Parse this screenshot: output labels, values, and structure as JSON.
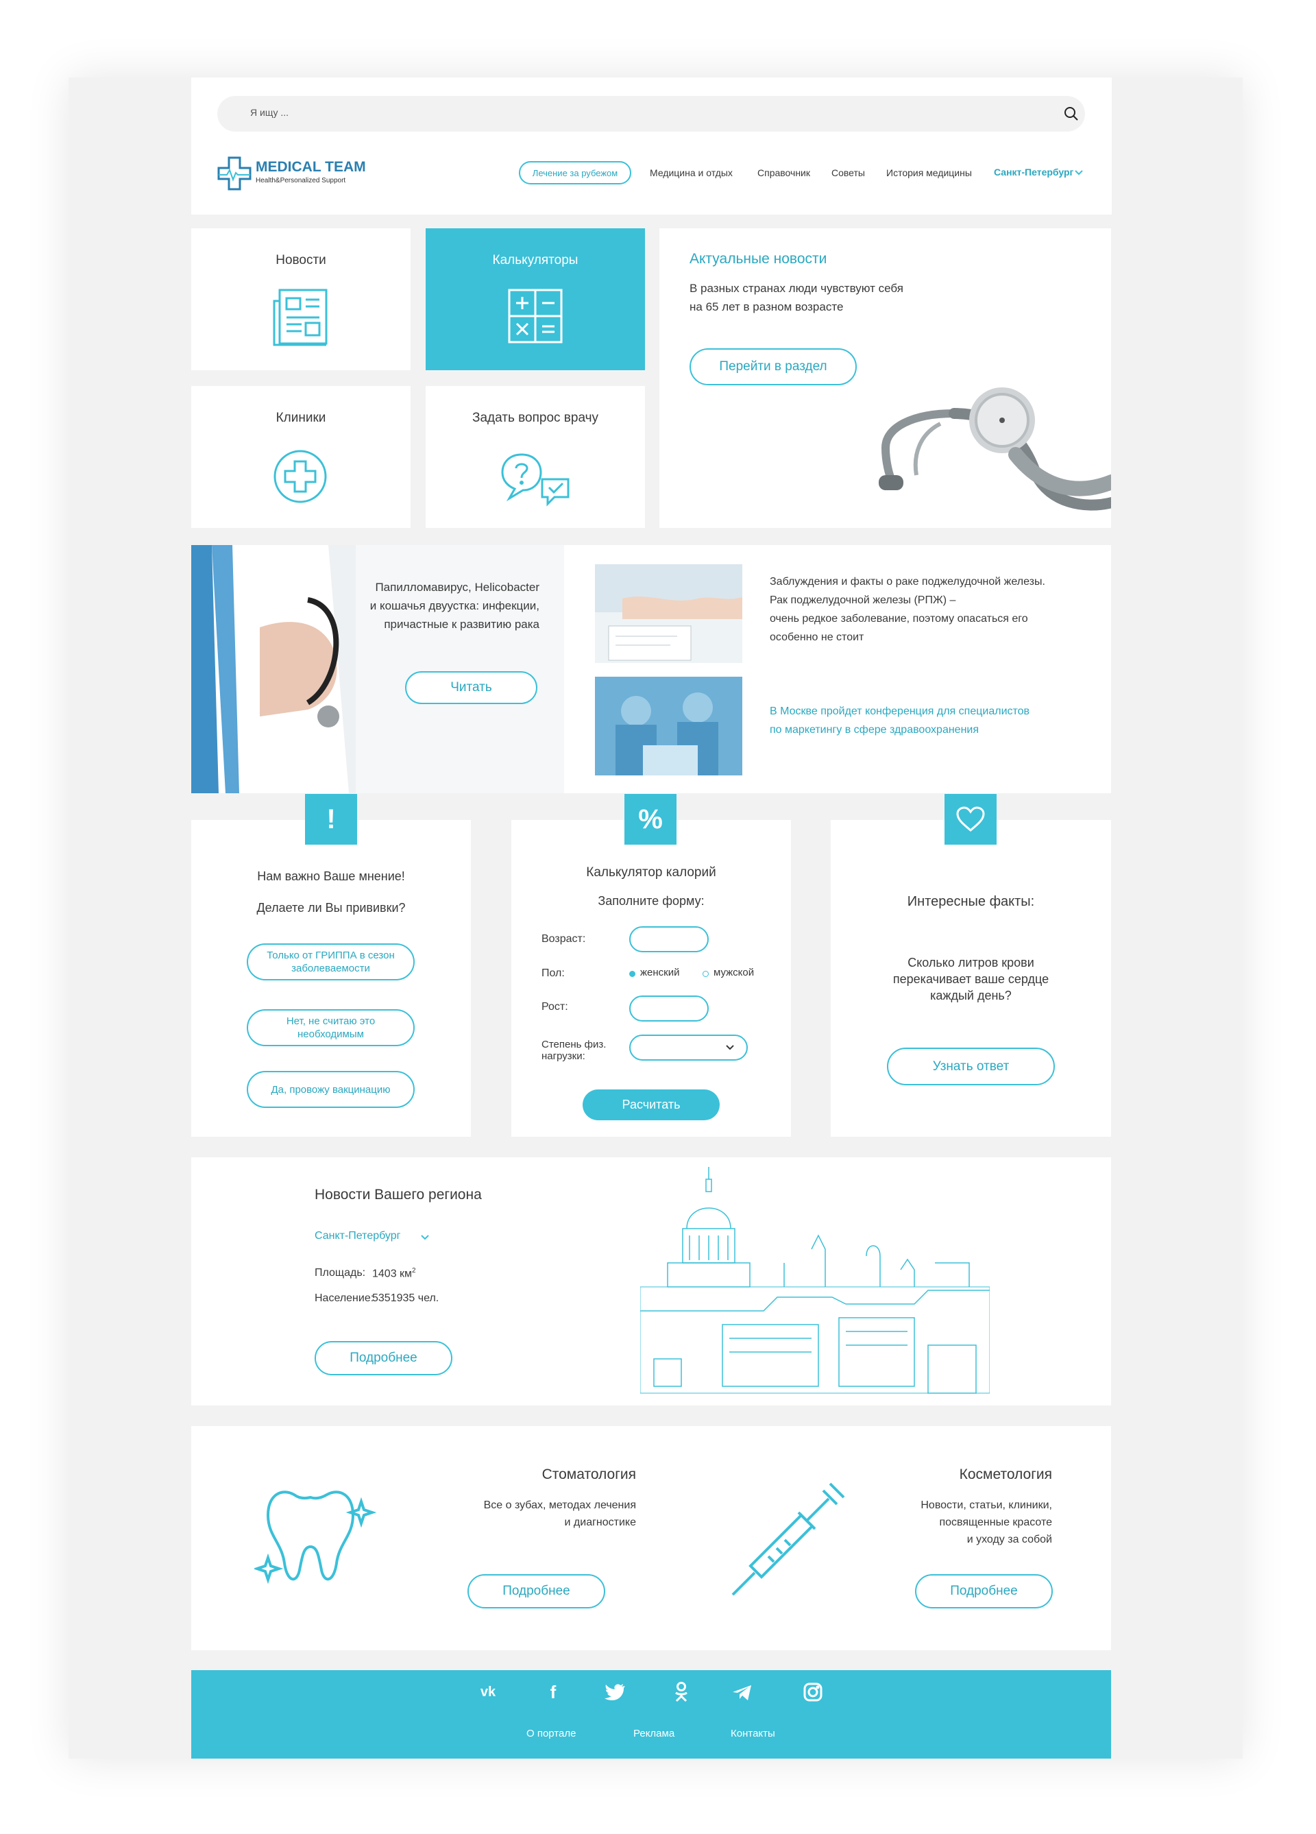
{
  "search": {
    "placeholder": "Я ищу ..."
  },
  "logo": {
    "title": "MEDICAL TEAM",
    "subtitle": "Health&Personalized Support"
  },
  "nav": {
    "items": [
      "Лечение за рубежом",
      "Медицина и отдых",
      "Справочник",
      "Советы",
      "История медицины"
    ],
    "city": "Санкт-Петербург"
  },
  "tiles": {
    "news": "Новости",
    "calculators": "Калькуляторы",
    "clinics": "Клиники",
    "ask": "Задать вопрос врачу"
  },
  "actual": {
    "title": "Актуальные новости",
    "text1": "В разных странах люди чувствуют себя",
    "text2": "на 65 лет в разном возрасте",
    "button": "Перейти в раздел"
  },
  "article": {
    "line1": "Папилломавирус, Helicobacter",
    "line2": "и кошачья двуустка: инфекции,",
    "line3": "причастные к развитию рака",
    "button": "Читать"
  },
  "news_list": {
    "item1": [
      "Заблуждения и факты о раке поджелудочной железы.",
      "Рак поджелудочной железы (РПЖ) –",
      "очень редкое заболевание, поэтому опасаться его",
      "особенно не стоит"
    ],
    "item2": [
      "В Москве пройдет конференция для специалистов",
      "по маркетингу в сфере здравоохранения"
    ]
  },
  "poll": {
    "icon": "!",
    "title": "Нам важно Ваше мнение!",
    "question": "Делаете ли Вы прививки?",
    "options": [
      "Только от ГРИППА в сезон заболеваемости",
      "Нет, не считаю это необходимым",
      "Да, провожу вакцинацию"
    ]
  },
  "calc": {
    "icon": "%",
    "title": "Калькулятор калорий",
    "subtitle": "Заполните форму:",
    "age": "Возраст:",
    "sex": "Пол:",
    "female": "женский",
    "male": "мужской",
    "height": "Рост:",
    "activity1": "Степень физ.",
    "activity2": "нагрузки:",
    "button": "Расчитать"
  },
  "facts": {
    "title": "Интересные факты:",
    "q1": "Сколько литров крови",
    "q2": "перекачивает ваше сердце",
    "q3": "каждый день?",
    "button": "Узнать ответ"
  },
  "region": {
    "title": "Новости Вашего региона",
    "city": "Санкт-Петербург",
    "area_label": "Площадь:",
    "area_value": "1403 км",
    "area_sup": "2",
    "pop_label": "Население:",
    "pop_value": "5351935 чел.",
    "button": "Подробнее"
  },
  "dental": {
    "title": "Стоматология",
    "l1": "Все о зубах, методах лечения",
    "l2": "и диагностике",
    "button": "Подробнее"
  },
  "cosmo": {
    "title": "Косметология",
    "l1": "Новости, статьи, клиники,",
    "l2": "посвященные красоте",
    "l3": "и уходу за собой",
    "button": "Подробнее"
  },
  "footer": {
    "links": [
      "О портале",
      "Реклама",
      "Контакты"
    ],
    "social": [
      "vk-icon",
      "facebook-icon",
      "twitter-icon",
      "odnoklassniki-icon",
      "telegram-icon",
      "instagram-icon"
    ]
  },
  "colors": {
    "accent": "#3bc0d8",
    "background": "#f2f2f2"
  }
}
